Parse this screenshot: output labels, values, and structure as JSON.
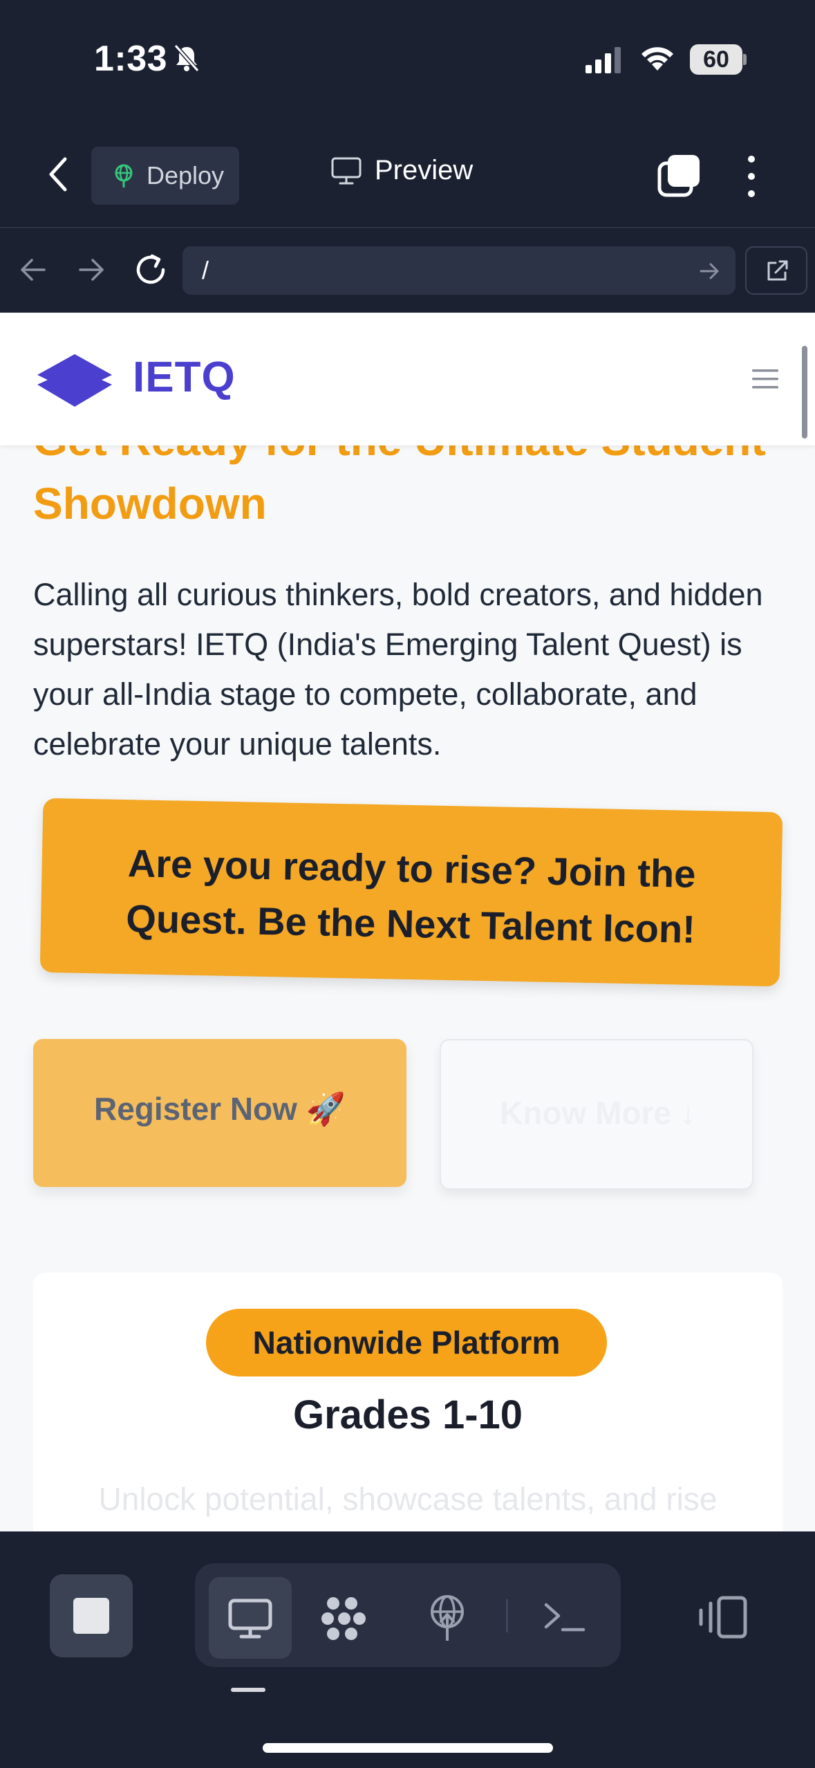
{
  "status_bar": {
    "time": "1:33",
    "battery": "60"
  },
  "app_header": {
    "deploy_label": "Deploy",
    "preview_label": "Preview"
  },
  "url_bar": {
    "url": "/"
  },
  "site": {
    "brand": "IETQ",
    "heading": "Get Ready for the Ultimate Student Showdown",
    "intro": "Calling all curious thinkers, bold creators, and hidden superstars! IETQ (India's Emerging Talent Quest) is your all-India stage to compete, collaborate, and celebrate your unique talents.",
    "cta_banner": "Are you ready to rise? Join the Quest. Be the Next Talent Icon!",
    "register_button": "Register Now 🚀",
    "know_more_button": "Know More ↓",
    "platform_badge": "Nationwide Platform",
    "grades": "Grades 1-10",
    "tagline": "Unlock potential, showcase talents, and rise"
  },
  "colors": {
    "accent_orange": "#f29c11",
    "brand_indigo": "#4a3fcf",
    "app_chrome": "#1c2131"
  },
  "icons": [
    "back-chevron-icon",
    "deploy-globe-icon",
    "monitor-icon",
    "tabs-icon",
    "more-vertical-icon",
    "arrow-left-icon",
    "arrow-right-icon",
    "reload-icon",
    "url-go-icon",
    "open-external-icon",
    "hamburger-icon",
    "stop-icon",
    "desktop-icon",
    "apps-grid-icon",
    "deploy-icon",
    "terminal-icon",
    "panel-toggle-icon"
  ]
}
